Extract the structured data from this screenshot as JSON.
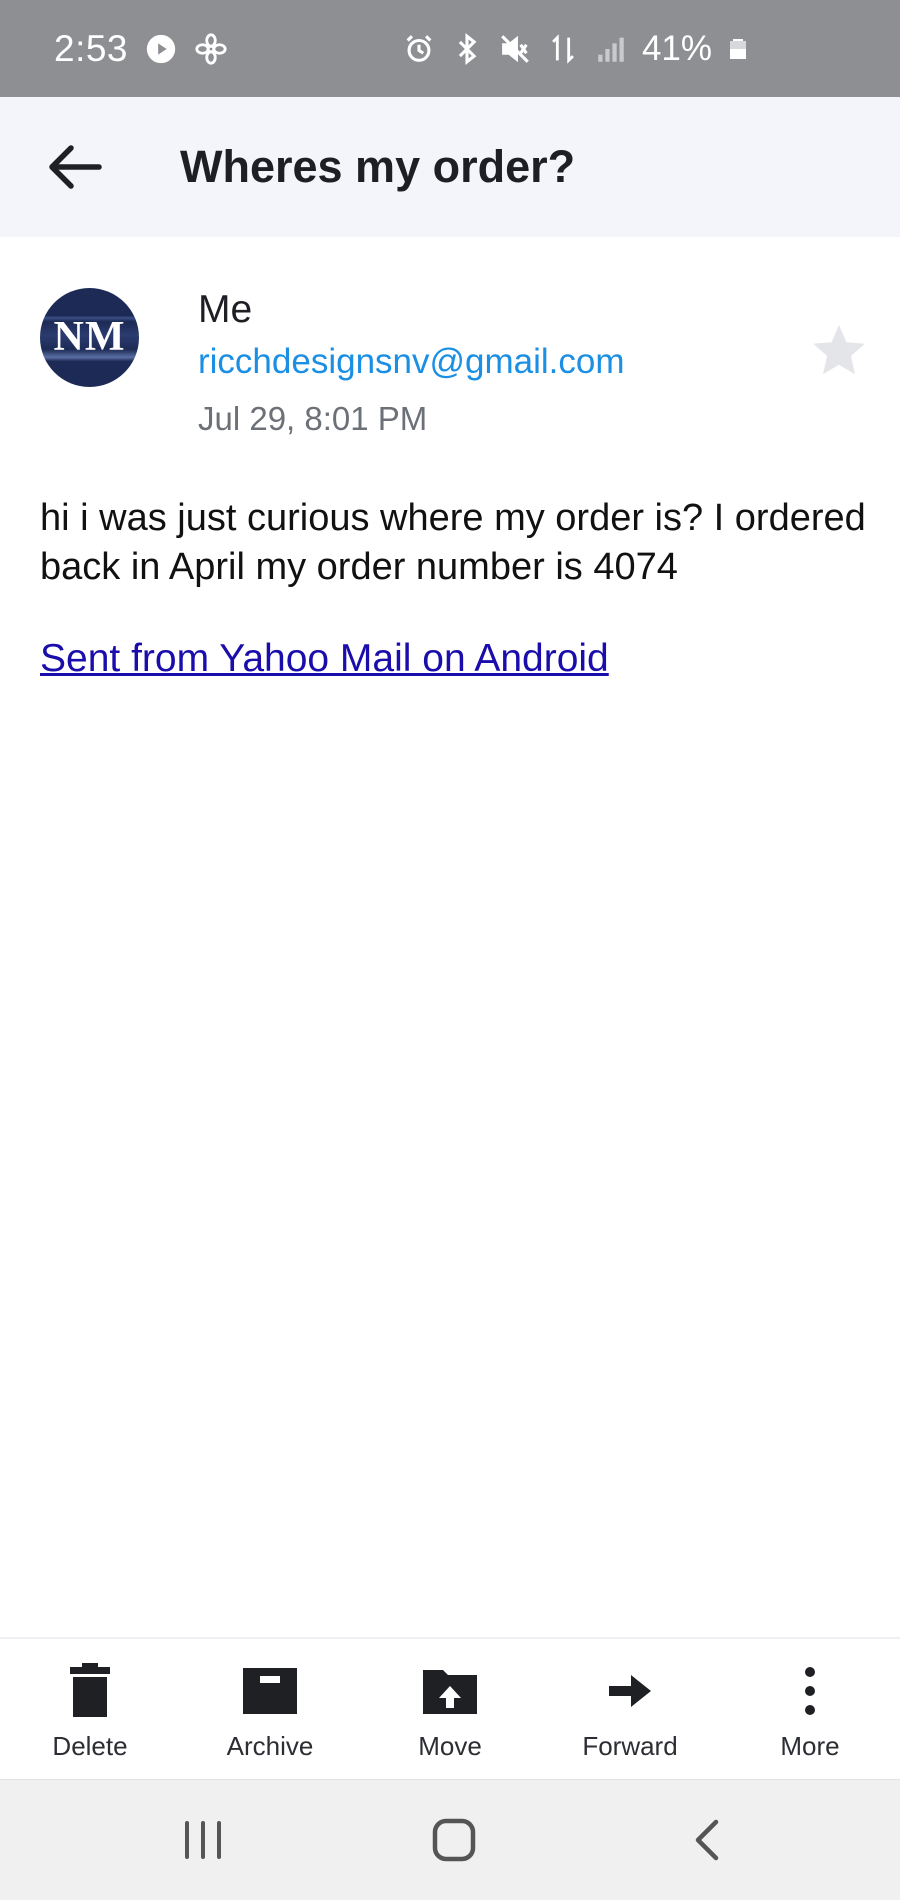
{
  "status_bar": {
    "time": "2:53",
    "battery_percent": "41%",
    "icons": [
      "play-circle-icon",
      "fan-icon",
      "alarm-icon",
      "bluetooth-icon",
      "mute-icon",
      "data-transfer-icon",
      "signal-icon",
      "battery-icon"
    ]
  },
  "header": {
    "title": "Wheres my order?",
    "back_icon": "arrow-left-icon"
  },
  "sender": {
    "avatar_initials": "NM",
    "name": "Me",
    "email": "ricchdesignsnv@gmail.com",
    "date": "Jul 29, 8:01 PM",
    "starred": false
  },
  "message": {
    "body": "hi i was just curious where my order is? I ordered back in April my order number is 4074",
    "signature_link": "Sent from Yahoo Mail on Android"
  },
  "toolbar": {
    "delete_label": "Delete",
    "archive_label": "Archive",
    "move_label": "Move",
    "forward_label": "Forward",
    "more_label": "More"
  },
  "colors": {
    "status_bar_bg": "#8e8f93",
    "header_bg": "#f3f5fb",
    "email_link": "#1a8fe3",
    "signature_link": "#1a0dab",
    "icon_dark": "#1f2024"
  }
}
